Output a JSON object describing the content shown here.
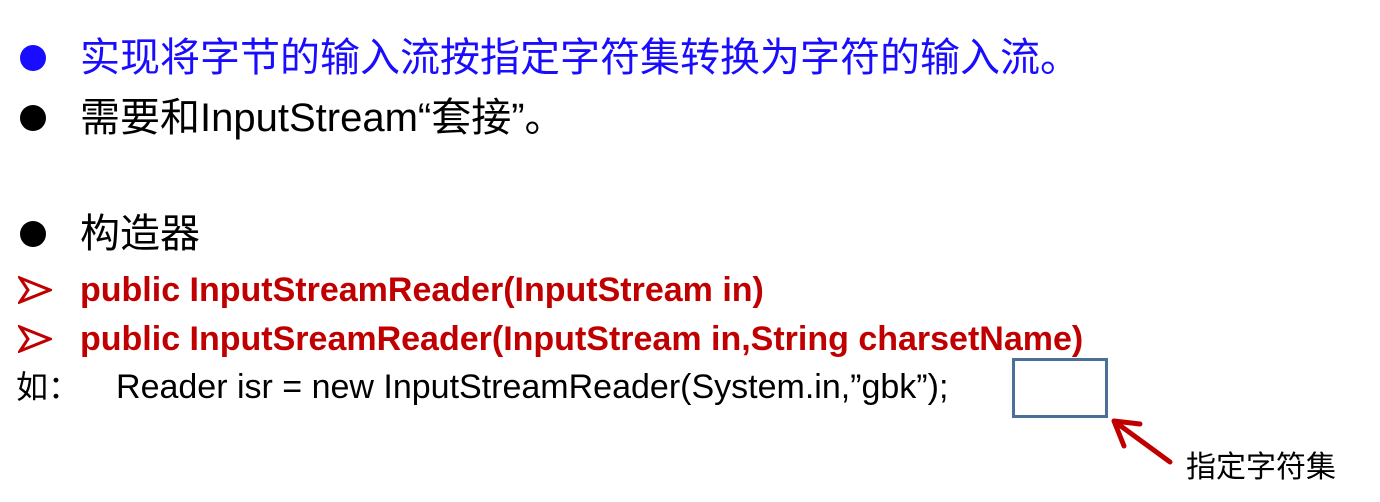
{
  "bullets": [
    {
      "text": "实现将字节的输入流按指定字符集转换为字符的输入流。",
      "color": "#1a0dff"
    },
    {
      "text": "需要和InputStream“套接”。",
      "color": "#000000"
    },
    {
      "text": "构造器",
      "color": "#000000"
    }
  ],
  "constructors": [
    {
      "text": "public InputStreamReader(InputStream in)"
    },
    {
      "text": "public InputSreamReader(InputStream in,String charsetName)"
    }
  ],
  "example": {
    "prefix": "如：",
    "code": "Reader isr = new InputStreamReader(System.in,”gbk”);"
  },
  "annotation": {
    "label": "指定字符集",
    "box_color": "#4a7099",
    "arrow_color": "#c00000"
  },
  "colors": {
    "accent_blue": "#1a0dff",
    "accent_red": "#c00000"
  }
}
